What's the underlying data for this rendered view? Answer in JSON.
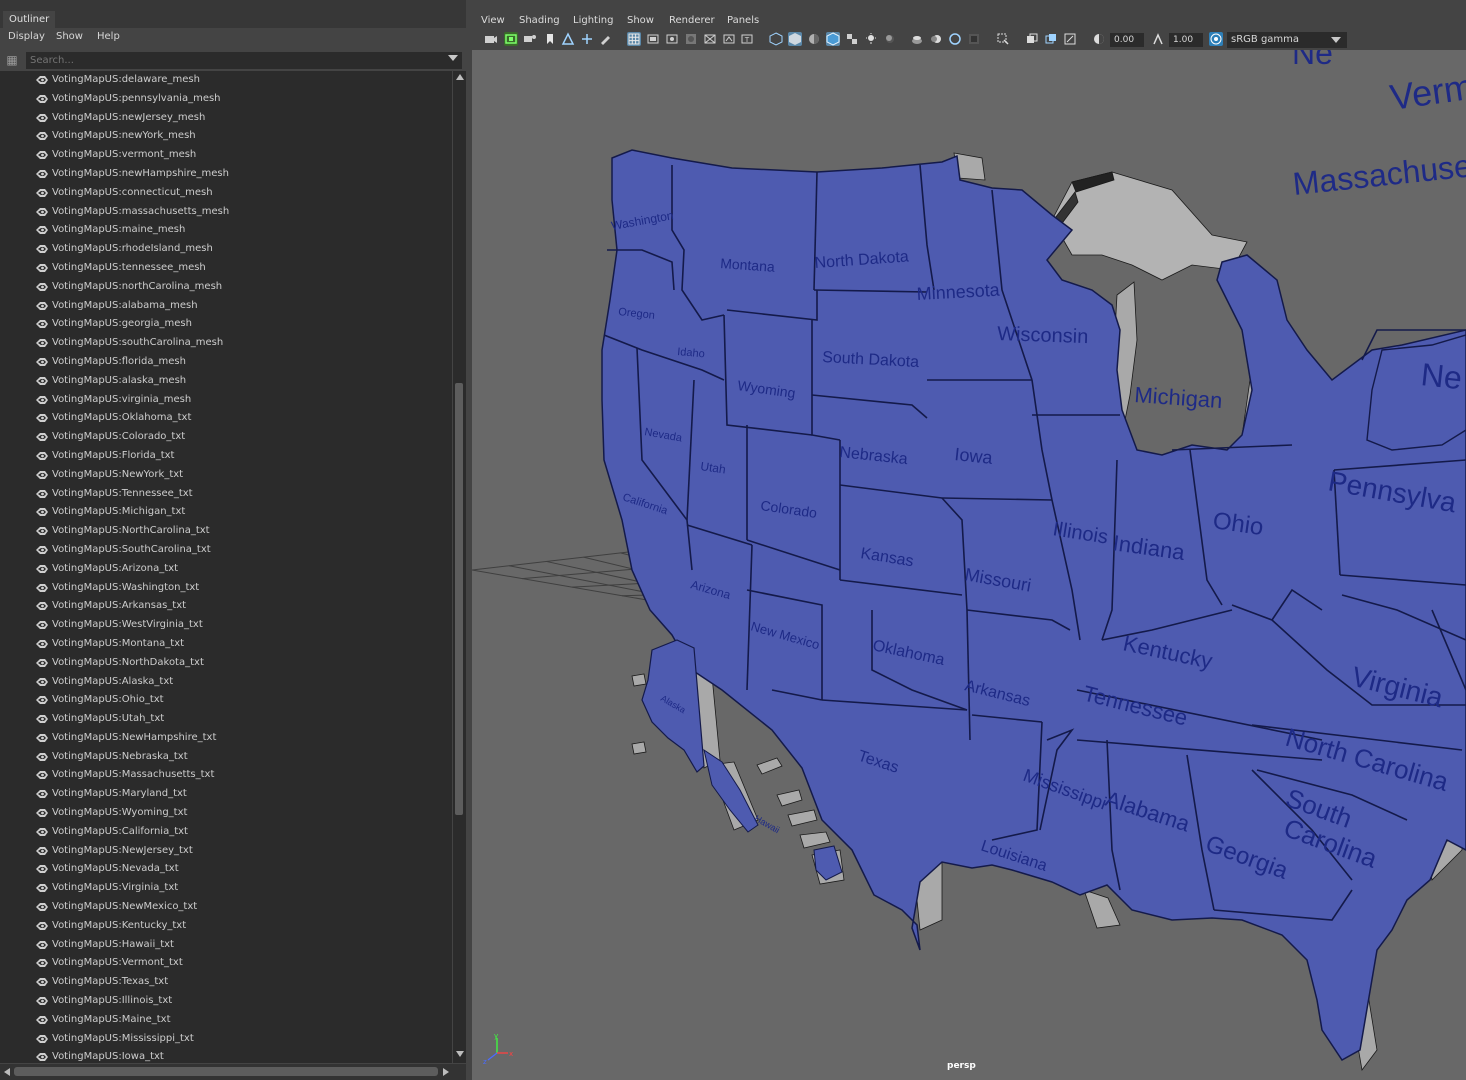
{
  "outliner": {
    "tab_label": "Outliner",
    "menu": [
      "Display",
      "Show",
      "Help"
    ],
    "search_placeholder": "Search...",
    "items": [
      "VotingMapUS:delaware_mesh",
      "VotingMapUS:pennsylvania_mesh",
      "VotingMapUS:newJersey_mesh",
      "VotingMapUS:newYork_mesh",
      "VotingMapUS:vermont_mesh",
      "VotingMapUS:newHampshire_mesh",
      "VotingMapUS:connecticut_mesh",
      "VotingMapUS:massachusetts_mesh",
      "VotingMapUS:maine_mesh",
      "VotingMapUS:rhodeIsland_mesh",
      "VotingMapUS:tennessee_mesh",
      "VotingMapUS:northCarolina_mesh",
      "VotingMapUS:alabama_mesh",
      "VotingMapUS:georgia_mesh",
      "VotingMapUS:southCarolina_mesh",
      "VotingMapUS:florida_mesh",
      "VotingMapUS:alaska_mesh",
      "VotingMapUS:virginia_mesh",
      "VotingMapUS:Oklahoma_txt",
      "VotingMapUS:Colorado_txt",
      "VotingMapUS:Florida_txt",
      "VotingMapUS:NewYork_txt",
      "VotingMapUS:Tennessee_txt",
      "VotingMapUS:Michigan_txt",
      "VotingMapUS:NorthCarolina_txt",
      "VotingMapUS:SouthCarolina_txt",
      "VotingMapUS:Arizona_txt",
      "VotingMapUS:Washington_txt",
      "VotingMapUS:Arkansas_txt",
      "VotingMapUS:WestVirginia_txt",
      "VotingMapUS:Montana_txt",
      "VotingMapUS:NorthDakota_txt",
      "VotingMapUS:Alaska_txt",
      "VotingMapUS:Ohio_txt",
      "VotingMapUS:Utah_txt",
      "VotingMapUS:NewHampshire_txt",
      "VotingMapUS:Nebraska_txt",
      "VotingMapUS:Massachusetts_txt",
      "VotingMapUS:Maryland_txt",
      "VotingMapUS:Wyoming_txt",
      "VotingMapUS:California_txt",
      "VotingMapUS:NewJersey_txt",
      "VotingMapUS:Nevada_txt",
      "VotingMapUS:Virginia_txt",
      "VotingMapUS:NewMexico_txt",
      "VotingMapUS:Kentucky_txt",
      "VotingMapUS:Hawaii_txt",
      "VotingMapUS:Vermont_txt",
      "VotingMapUS:Texas_txt",
      "VotingMapUS:Illinois_txt",
      "VotingMapUS:Maine_txt",
      "VotingMapUS:Mississippi_txt",
      "VotingMapUS:Iowa_txt"
    ]
  },
  "viewport": {
    "menu": [
      "View",
      "Shading",
      "Lighting",
      "Show",
      "Renderer",
      "Panels"
    ],
    "exposure": "0.00",
    "gamma": "1.00",
    "color_space": "sRGB gamma",
    "camera": "persp",
    "map_color": "#4e5bb0",
    "extrude_color": "#b0b0b0",
    "label_color": "#1e2a86",
    "state_labels": {
      "washington": "Washington",
      "oregon": "Oregon",
      "california": "California",
      "nevada": "Nevada",
      "idaho": "Idaho",
      "montana": "Montana",
      "wyoming": "Wyoming",
      "utah": "Utah",
      "arizona": "Arizona",
      "colorado": "Colorado",
      "newmexico": "New Mexico",
      "northdakota": "North Dakota",
      "southdakota": "South Dakota",
      "nebraska": "Nebraska",
      "kansas": "Kansas",
      "oklahoma": "Oklahoma",
      "texas": "Texas",
      "minnesota": "Minnesota",
      "iowa": "Iowa",
      "missouri": "Missouri",
      "arkansas": "Arkansas",
      "louisiana": "Louisiana",
      "wisconsin": "Wisconsin",
      "illinois": "Illinois",
      "michigan": "Michigan",
      "indiana": "Indiana",
      "ohio": "Ohio",
      "kentucky": "Kentucky",
      "tennessee": "Tennessee",
      "mississippi": "Mississippi",
      "alabama": "Alabama",
      "georgia": "Georgia",
      "southcarolina1": "South",
      "southcarolina2": "Carolina",
      "northcarolina": "North Carolina",
      "virginia": "Virginia",
      "pennsylvania": "Pennsylva",
      "ny_partial": "Ne",
      "alaska": "Alaska",
      "hawaii": "Hawaii",
      "vermont": "Verm",
      "massachusetts": "Massachuse",
      "newhampshire_partial": "Ne"
    }
  }
}
